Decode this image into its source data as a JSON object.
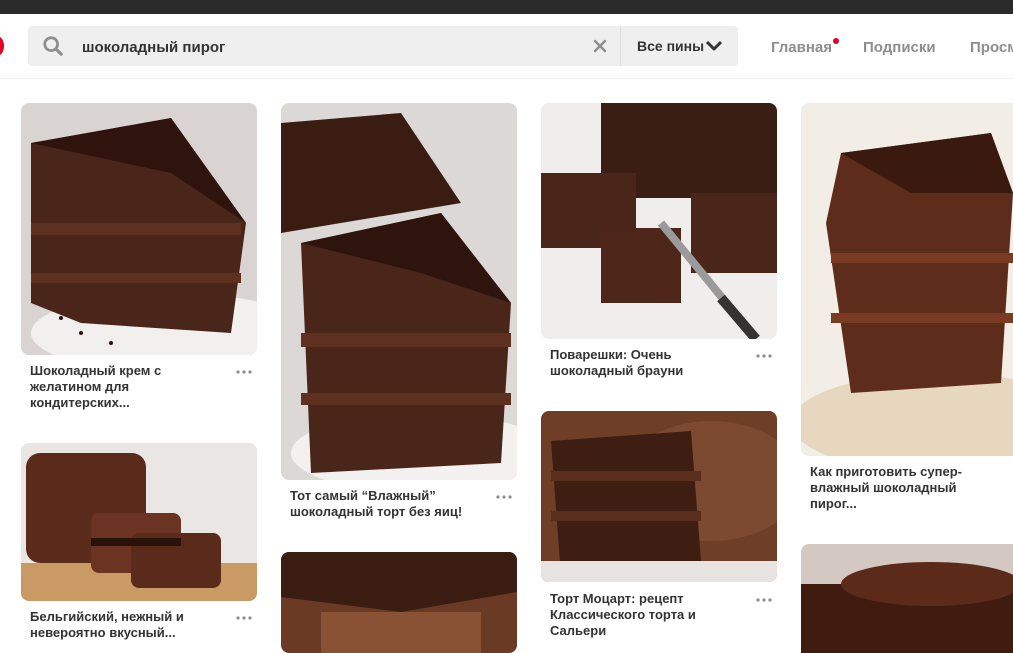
{
  "search": {
    "query": "шоколадный пирог",
    "scope_label": "Все пины"
  },
  "nav": {
    "home": "Главная",
    "subscriptions": "Подписки",
    "views": "Просм"
  },
  "pins": [
    {
      "title": "Шоколадный крем с желатином для кондитерских..."
    },
    {
      "title": "Бельгийский, нежный и невероятно вкусный..."
    },
    {
      "title": "Тот самый “Влажный” шоколадный торт без яиц!"
    },
    {
      "title": ""
    },
    {
      "title": "Поварешки: Очень шоколадный брауни"
    },
    {
      "title": "Торт Моцарт: рецепт Классического торта и Сальери"
    },
    {
      "title": "Как приготовить супер-влажный шоколадный пирог..."
    },
    {
      "title": ""
    }
  ],
  "icons": {
    "search": "search-icon",
    "clear": "close-icon",
    "chevron": "chevron-down-icon",
    "more": "more-horizontal-icon"
  },
  "colors": {
    "accent": "#e60023",
    "search_bg": "#efefef",
    "chocolate": "#3b1f17"
  }
}
